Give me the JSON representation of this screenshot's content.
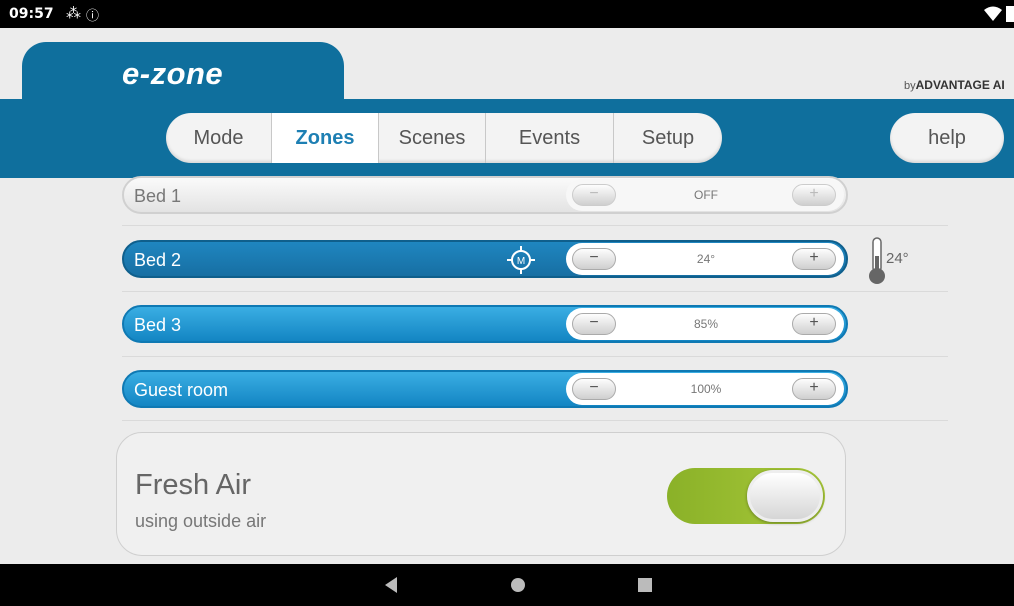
{
  "status_bar": {
    "time": "09:57",
    "icons": [
      "notification-icon",
      "info-icon",
      "wifi-icon",
      "battery-icon"
    ]
  },
  "header": {
    "logo": "e-zone",
    "brand_prefix": "by",
    "brand_name": "ADVANTAGE AI"
  },
  "tabs": [
    {
      "label": "Mode",
      "active": false
    },
    {
      "label": "Zones",
      "active": true
    },
    {
      "label": "Scenes",
      "active": false
    },
    {
      "label": "Events",
      "active": false
    },
    {
      "label": "Setup",
      "active": false
    }
  ],
  "help_label": "help",
  "zones": [
    {
      "name": "Bed 1",
      "value": "OFF",
      "state": "off",
      "minus": "−",
      "plus": "+"
    },
    {
      "name": "Bed 2",
      "value": "24°",
      "state": "myzone",
      "minus": "−",
      "plus": "+"
    },
    {
      "name": "Bed 3",
      "value": "85%",
      "state": "on",
      "minus": "−",
      "plus": "+"
    },
    {
      "name": "Guest room",
      "value": "100%",
      "state": "on",
      "minus": "−",
      "plus": "+"
    }
  ],
  "myzone_badge": "M",
  "sensor_temp": "24°",
  "fresh_air": {
    "title": "Fresh Air",
    "subtitle": "using outside air",
    "enabled": true
  },
  "colors": {
    "brand_blue": "#0f6f9d",
    "zone_on": "#1385c3",
    "toggle_on": "#a9c93a"
  }
}
